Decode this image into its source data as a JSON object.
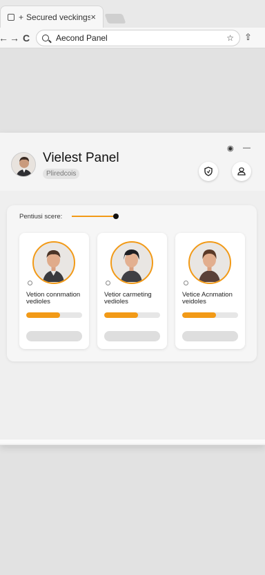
{
  "browser": {
    "tab": {
      "plus": "+",
      "title": "Secured veckings",
      "close": "×"
    },
    "nav": {
      "back": "←",
      "forward": "→",
      "reload": "C"
    },
    "address": {
      "url": "Aecond Panel",
      "star": "☆"
    },
    "extension": "⇧"
  },
  "panel": {
    "title": "Vielest Panel",
    "badge": "Pliredcois",
    "actions": {
      "info": "◉",
      "minimize": "—"
    },
    "icons": {
      "shield": "shield-icon",
      "profile": "person-icon"
    }
  },
  "content": {
    "slider": {
      "label": "Pentiusi scere:",
      "value": 0.85
    },
    "cards": [
      {
        "title": "Vetion connmation vedioles",
        "progress": 0.6
      },
      {
        "title": "Vetior carmeting vedioles",
        "progress": 0.6
      },
      {
        "title": "Vetice Acnmation veidoles",
        "progress": 0.6
      }
    ]
  },
  "colors": {
    "accent": "#f29a17",
    "surface": "#ffffff",
    "background": "#e2e2e2"
  }
}
